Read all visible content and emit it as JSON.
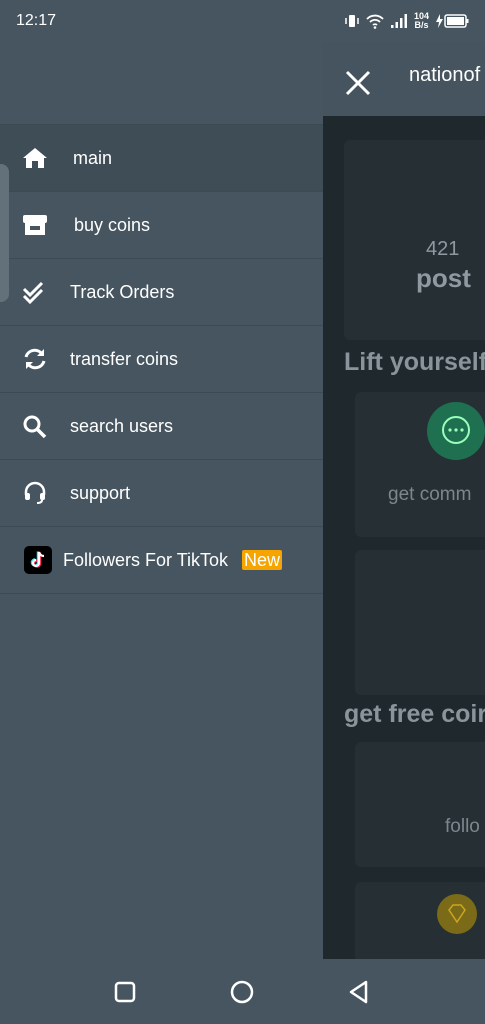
{
  "status_bar": {
    "time": "12:17",
    "net_speed_top": "104",
    "net_speed_bottom": "B/s",
    "icons": [
      "vibrate-icon",
      "wifi-icon",
      "signal-icon",
      "battery-charging-icon"
    ]
  },
  "app_bar": {
    "title": "nationof",
    "close_icon": "close-icon"
  },
  "background_page": {
    "post_count": "421",
    "post_label": "post",
    "section_1": "Lift yourself",
    "card_1_text": "get comm",
    "section_2": "get free coir",
    "card_3_text": "follo"
  },
  "drawer": {
    "items": [
      {
        "label": "main",
        "icon": "home-icon",
        "active": true
      },
      {
        "label": "buy coins",
        "icon": "store-icon"
      },
      {
        "label": "Track Orders",
        "icon": "double-check-icon"
      },
      {
        "label": "transfer coins",
        "icon": "sync-icon"
      },
      {
        "label": "search users",
        "icon": "search-icon"
      },
      {
        "label": "support",
        "icon": "headset-icon"
      },
      {
        "label": "Followers For TikTok",
        "icon": "tiktok-icon",
        "badge": "New"
      }
    ]
  },
  "navbar": {
    "buttons": [
      "recents-square-icon",
      "home-circle-icon",
      "back-triangle-icon"
    ]
  },
  "colors": {
    "drawer_bg": "#46555f",
    "page_bg": "#1f282d",
    "badge": "#f5a400",
    "accent_green": "#1f6f51"
  }
}
